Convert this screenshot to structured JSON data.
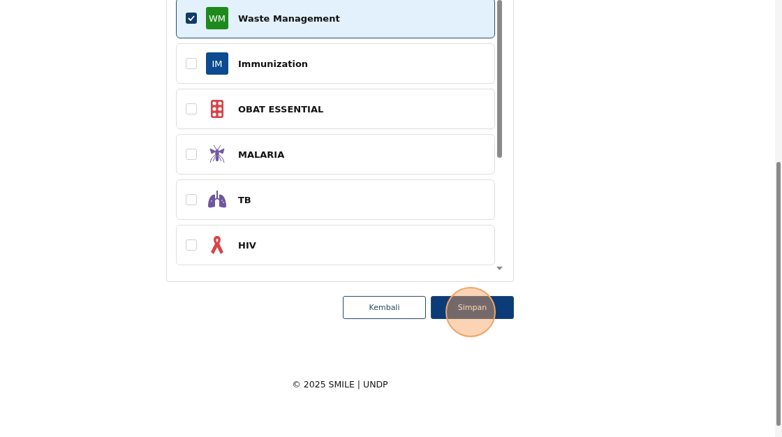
{
  "programs": [
    {
      "kind": "initials",
      "initials": "WM",
      "color": "#1e8a1e",
      "label": "Waste Management",
      "checked": true
    },
    {
      "kind": "initials",
      "initials": "IM",
      "color": "#0d4a8f",
      "label": "Immunization",
      "checked": false
    },
    {
      "kind": "pills",
      "label": "OBAT ESSENTIAL",
      "checked": false
    },
    {
      "kind": "mosquito",
      "label": "MALARIA",
      "checked": false
    },
    {
      "kind": "lungs",
      "label": "TB",
      "checked": false
    },
    {
      "kind": "ribbon",
      "label": "HIV",
      "checked": false
    }
  ],
  "buttons": {
    "back": "Kembali",
    "save": "Simpan"
  },
  "footer": "© 2025 SMILE | UNDP"
}
